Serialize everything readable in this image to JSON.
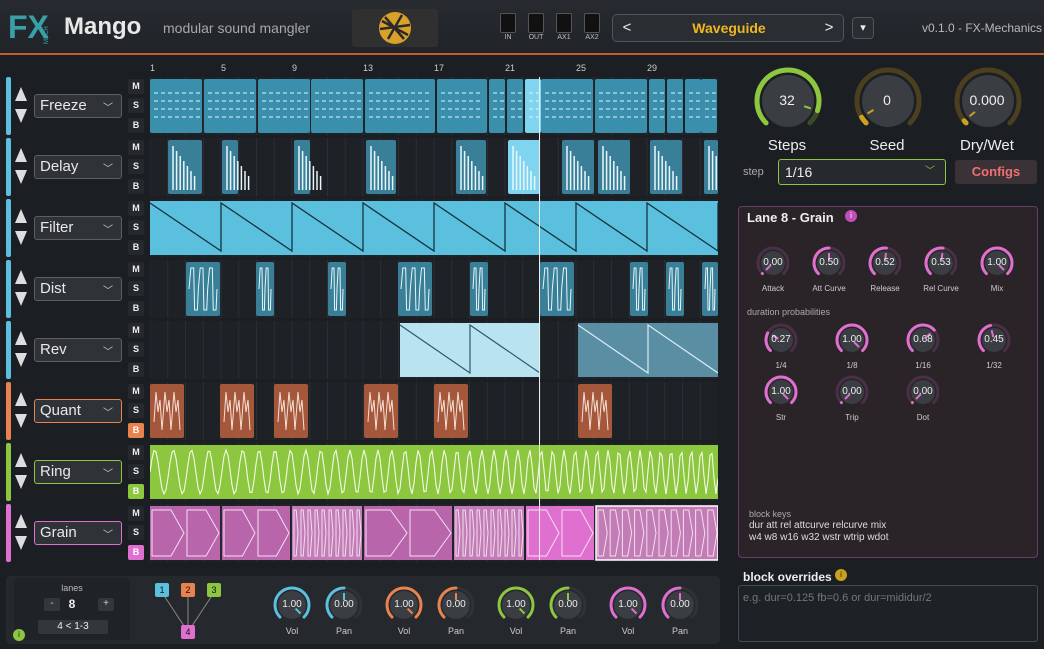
{
  "header": {
    "app_title": "Mango",
    "subtitle": "modular sound mangler",
    "meters": [
      "IN",
      "OUT",
      "AX1",
      "AX2"
    ],
    "preset": {
      "name": "Waveguide",
      "prev": "<",
      "next": ">",
      "menu": "▾"
    },
    "version": "v0.1.0  -  FX-Mechanics"
  },
  "ruler": [
    "1",
    "5",
    "9",
    "13",
    "17",
    "21",
    "25",
    "29"
  ],
  "lanes": [
    {
      "name": "Freeze",
      "color": "#5bc0de",
      "b_active": false
    },
    {
      "name": "Delay",
      "color": "#5bc0de",
      "b_active": false
    },
    {
      "name": "Filter",
      "color": "#5bc0de",
      "b_active": false
    },
    {
      "name": "Dist",
      "color": "#5bc0de",
      "b_active": false
    },
    {
      "name": "Rev",
      "color": "#5bc0de",
      "b_active": false
    },
    {
      "name": "Quant",
      "color": "#e8834f",
      "b_active": true
    },
    {
      "name": "Ring",
      "color": "#8dc63f",
      "b_active": true
    },
    {
      "name": "Grain",
      "color": "#e070d0",
      "b_active": true
    }
  ],
  "msb": {
    "m": "M",
    "s": "S",
    "b": "B"
  },
  "top_knobs": {
    "steps": {
      "value": "32",
      "label": "Steps",
      "level": 0.9
    },
    "seed": {
      "value": "0",
      "label": "Seed",
      "level": 0.05
    },
    "drywet": {
      "value": "0.000",
      "label": "Dry/Wet",
      "level": 0.02
    }
  },
  "step": {
    "label": "step",
    "value": "1/16",
    "configs": "Configs"
  },
  "lane_detail": {
    "title": "Lane 8  -  Grain",
    "env_knobs": [
      {
        "value": "0.00",
        "label": "Attack"
      },
      {
        "value": "0.50",
        "label": "Att Curve"
      },
      {
        "value": "0.52",
        "label": "Release"
      },
      {
        "value": "0.53",
        "label": "Rel Curve"
      },
      {
        "value": "1.00",
        "label": "Mix"
      }
    ],
    "duration_label": "duration probabilities",
    "dur_knobs": [
      {
        "value": "0.27",
        "label": "1/4"
      },
      {
        "value": "1.00",
        "label": "1/8"
      },
      {
        "value": "0.68",
        "label": "1/16"
      },
      {
        "value": "0.45",
        "label": "1/32"
      },
      {
        "value": "1.00",
        "label": "Str"
      },
      {
        "value": "0.00",
        "label": "Trip"
      },
      {
        "value": "0.00",
        "label": "Dot"
      }
    ],
    "block_keys_label": "block keys",
    "block_keys_line1": "dur att rel attcurve relcurve mix",
    "block_keys_line2": "w4 w8 w16 w32 wstr wtrip wdot"
  },
  "overrides": {
    "title": "block overrides",
    "placeholder": "e.g.  dur=0.125 fb=0.6   or   dur=mididur/2"
  },
  "bottom": {
    "lanes_label": "lanes",
    "lanes_value": "8",
    "minus": "-",
    "plus": "+",
    "routing_text": "4 < 1-3",
    "nodes": [
      "1",
      "2",
      "3",
      "4"
    ],
    "mix_knobs": [
      {
        "value": "1.00",
        "label": "Vol",
        "color": "#5bc0de"
      },
      {
        "value": "0.00",
        "label": "Pan",
        "color": "#5bc0de"
      },
      {
        "value": "1.00",
        "label": "Vol",
        "color": "#e8834f"
      },
      {
        "value": "0.00",
        "label": "Pan",
        "color": "#e8834f"
      },
      {
        "value": "1.00",
        "label": "Vol",
        "color": "#8dc63f"
      },
      {
        "value": "0.00",
        "label": "Pan",
        "color": "#8dc63f"
      },
      {
        "value": "1.00",
        "label": "Vol",
        "color": "#e070d0"
      },
      {
        "value": "0.00",
        "label": "Pan",
        "color": "#e070d0"
      }
    ]
  }
}
